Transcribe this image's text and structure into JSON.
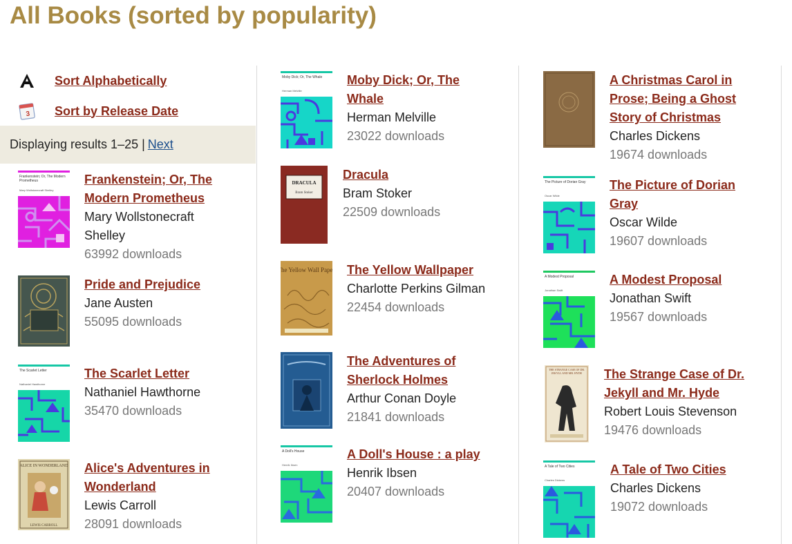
{
  "page": {
    "title": "All Books (sorted by popularity)"
  },
  "sort": {
    "alpha_label": "Sort Alphabetically",
    "date_label": "Sort by Release Date",
    "alpha_icon": "letter-a-icon",
    "date_icon": "calendar-icon"
  },
  "results": {
    "text": "Displaying results 1–25 |",
    "next_label": "Next"
  },
  "colors": {
    "title": "#a88a44",
    "link": "#8b2a1a",
    "next_link": "#1a4d8b",
    "results_bg": "#eeebe0"
  },
  "books": [
    {
      "title": "Frankenstein; Or, The Modern Prometheus",
      "title_lines": [
        "Frankenstein; Or, The",
        "Modern Prometheus"
      ],
      "author_lines": [
        "Mary Wollstonecraft",
        "Shelley"
      ],
      "downloads": "63992 downloads",
      "cover_title": "Frankenstein; Or, The Modern Prometheus",
      "cover_author": "Mary Wollstonecraft Shelley"
    },
    {
      "title": "Pride and Prejudice",
      "title_lines": [
        "Pride and Prejudice"
      ],
      "author_lines": [
        "Jane Austen"
      ],
      "downloads": "55095 downloads"
    },
    {
      "title": "The Scarlet Letter",
      "title_lines": [
        "The Scarlet Letter"
      ],
      "author_lines": [
        "Nathaniel Hawthorne"
      ],
      "downloads": "35470 downloads",
      "cover_title": "The Scarlet Letter",
      "cover_author": "Nathaniel Hawthorne"
    },
    {
      "title": "Alice's Adventures in Wonderland",
      "title_lines": [
        "Alice's Adventures in",
        "Wonderland"
      ],
      "author_lines": [
        "Lewis Carroll"
      ],
      "downloads": "28091 downloads",
      "cover_title": "ALICE IN WONDERLAND",
      "cover_author": "LEWIS CARROLL"
    },
    {
      "title": "Moby Dick; Or, The Whale",
      "title_lines": [
        "Moby Dick; Or, The",
        "Whale"
      ],
      "author_lines": [
        "Herman Melville"
      ],
      "downloads": "23022 downloads",
      "cover_title": "Moby Dick; Or, The Whale",
      "cover_author": "Herman Melville"
    },
    {
      "title": "Dracula",
      "title_lines": [
        "Dracula"
      ],
      "author_lines": [
        "Bram Stoker"
      ],
      "downloads": "22509 downloads",
      "cover_title": "DRACULA",
      "cover_author": "Bram Stoker"
    },
    {
      "title": "The Yellow Wallpaper",
      "title_lines": [
        "The Yellow Wallpaper"
      ],
      "author_lines": [
        "Charlotte Perkins Gilman"
      ],
      "downloads": "22454 downloads",
      "cover_title": "The Yellow Wall Paper"
    },
    {
      "title": "The Adventures of Sherlock Holmes",
      "title_lines": [
        "The Adventures of",
        "Sherlock Holmes"
      ],
      "author_lines": [
        "Arthur Conan Doyle"
      ],
      "downloads": "21841 downloads"
    },
    {
      "title": "A Doll's House : a play",
      "title_lines": [
        "A Doll's House : a play"
      ],
      "author_lines": [
        "Henrik Ibsen"
      ],
      "downloads": "20407 downloads",
      "cover_title": "A Doll's House",
      "cover_author": "Henrik Ibsen"
    },
    {
      "title": "A Christmas Carol in Prose; Being a Ghost Story of Christmas",
      "title_lines": [
        "A Christmas Carol in",
        "Prose; Being a Ghost",
        "Story of Christmas"
      ],
      "author_lines": [
        "Charles Dickens"
      ],
      "downloads": "19674 downloads"
    },
    {
      "title": "The Picture of Dorian Gray",
      "title_lines": [
        "The Picture of Dorian",
        "Gray"
      ],
      "author_lines": [
        "Oscar Wilde"
      ],
      "downloads": "19607 downloads",
      "cover_title": "The Picture of Dorian Gray",
      "cover_author": "Oscar Wilde"
    },
    {
      "title": "A Modest Proposal",
      "title_lines": [
        "A Modest Proposal"
      ],
      "author_lines": [
        "Jonathan Swift"
      ],
      "downloads": "19567 downloads",
      "cover_title": "A Modest Proposal",
      "cover_author": "Jonathan Swift"
    },
    {
      "title": "The Strange Case of Dr. Jekyll and Mr. Hyde",
      "title_lines": [
        "The Strange Case of Dr.",
        "Jekyll and Mr. Hyde"
      ],
      "author_lines": [
        "Robert Louis Stevenson"
      ],
      "downloads": "19476 downloads",
      "cover_title": "THE STRANGE CASE OF DR. JEKYLL AND MR. HYDE"
    },
    {
      "title": "A Tale of Two Cities",
      "title_lines": [
        "A Tale of Two Cities"
      ],
      "author_lines": [
        "Charles Dickens"
      ],
      "downloads": "19072 downloads",
      "cover_title": "A Tale of Two Cities",
      "cover_author": "Charles Dickens"
    }
  ]
}
